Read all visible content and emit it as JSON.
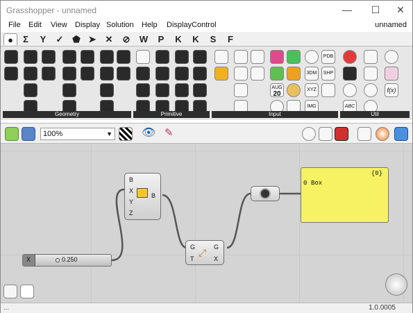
{
  "window": {
    "title": "Grasshopper - unnamed",
    "doc_name": "unnamed"
  },
  "menu": [
    "File",
    "Edit",
    "View",
    "Display",
    "Solution",
    "Help",
    "DisplayControl"
  ],
  "tabs": [
    "●",
    "Σ",
    "Y",
    "✓",
    "⬟",
    "➤",
    "✕",
    "⊘",
    "W",
    "P",
    "K",
    "K",
    "S",
    "F"
  ],
  "ribbon": {
    "groups": [
      "Geometry",
      "Primitive",
      "Input",
      "Util"
    ],
    "input_labels": {
      "month": "AUG",
      "day": "20",
      "pdb": "PDB",
      "shp": "SHP",
      "3dm": "3DM",
      "xyz": "XYZ",
      "img": "IMG"
    },
    "util_labels": {
      "fx": "f(x)",
      "abc": "ABC"
    }
  },
  "toolbar": {
    "zoom": "100%"
  },
  "canvas": {
    "box_node": {
      "inputs": [
        "B",
        "X",
        "Y",
        "Z"
      ],
      "output": "B"
    },
    "split_node": {
      "inputs": [
        "G",
        "T"
      ],
      "outputs": [
        "G",
        "X"
      ]
    },
    "slider": {
      "label": "X",
      "value": "0.250"
    },
    "panel": {
      "header": "{0}",
      "line_index": "0",
      "line_text": "Box"
    }
  },
  "status": {
    "version": "1.0.0005"
  }
}
